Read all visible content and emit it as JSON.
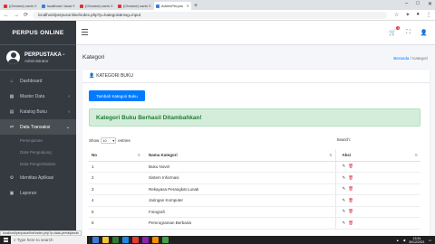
{
  "browser": {
    "tabs": [
      {
        "label": "(Chrome) contoh - YouTube Stu",
        "active": false
      },
      {
        "label": "localhost / localhost / perpusta",
        "active": false
      },
      {
        "label": "(Chrome) contoh - YouTube Stu",
        "active": false
      },
      {
        "label": "(Chrome) contoh - YouTube Stu",
        "active": false
      },
      {
        "label": "AdminPerpus",
        "active": true
      }
    ],
    "url": "localhost/perpusonline/index.php?p=kategori&msg=input",
    "window_controls": [
      "–",
      "□",
      "✕"
    ]
  },
  "sidebar": {
    "brand": "PERPUS ONLINE",
    "user_name": "PERPUSTAKA -",
    "user_role": "Administrator",
    "items": [
      {
        "label": "Dashboard",
        "icon": "home-icon",
        "glyph": "⌂",
        "chevron": ""
      },
      {
        "label": "Master Data",
        "icon": "grid-icon",
        "glyph": "▦",
        "chevron": "‹"
      },
      {
        "label": "Katalog Buku",
        "icon": "book-icon",
        "glyph": "▤",
        "chevron": "‹"
      },
      {
        "label": "Data Transaksi",
        "icon": "exchange-icon",
        "glyph": "⇄",
        "chevron": "⌄"
      }
    ],
    "subitems": [
      "Peminjaman",
      "Data Pengunjung",
      "Data Pengembalian"
    ],
    "items_after": [
      {
        "label": "Identitas Aplikasi",
        "icon": "gear-icon",
        "glyph": "⚙"
      },
      {
        "label": "Laporan",
        "icon": "file-icon",
        "glyph": "▣"
      }
    ]
  },
  "navbar": {
    "badge_count": "1"
  },
  "page": {
    "title": "Kategori",
    "breadcrumb_home": "Beranda",
    "breadcrumb_sep": "/",
    "breadcrumb_current": "Kategori"
  },
  "card": {
    "header": "KATEGORI BUKU",
    "add_button": "Tambah Kategori Buku",
    "alert": "Kategori Buku Berhasil Ditambahkan!",
    "show_label": "Show",
    "entries_value": "10",
    "entries_label": "entries",
    "search_label": "Search:",
    "columns": [
      "No",
      "Nama Kategori",
      "Aksi"
    ],
    "rows": [
      {
        "no": "1",
        "name": "Buku Novel"
      },
      {
        "no": "2",
        "name": "Sistem Informasi"
      },
      {
        "no": "3",
        "name": "Rekayasa Perangkat Lunak"
      },
      {
        "no": "4",
        "name": "Jaringan Komputer"
      },
      {
        "no": "5",
        "name": "Fotografi"
      },
      {
        "no": "6",
        "name": "Pemrograman Berbasis"
      }
    ]
  },
  "statusbar": {
    "link": "localhost/perpusonline/index.php?p=data-peminjaman"
  },
  "taskbar": {
    "search_placeholder": "Type here to search",
    "time": "13:34",
    "date": "30/12/2021"
  }
}
